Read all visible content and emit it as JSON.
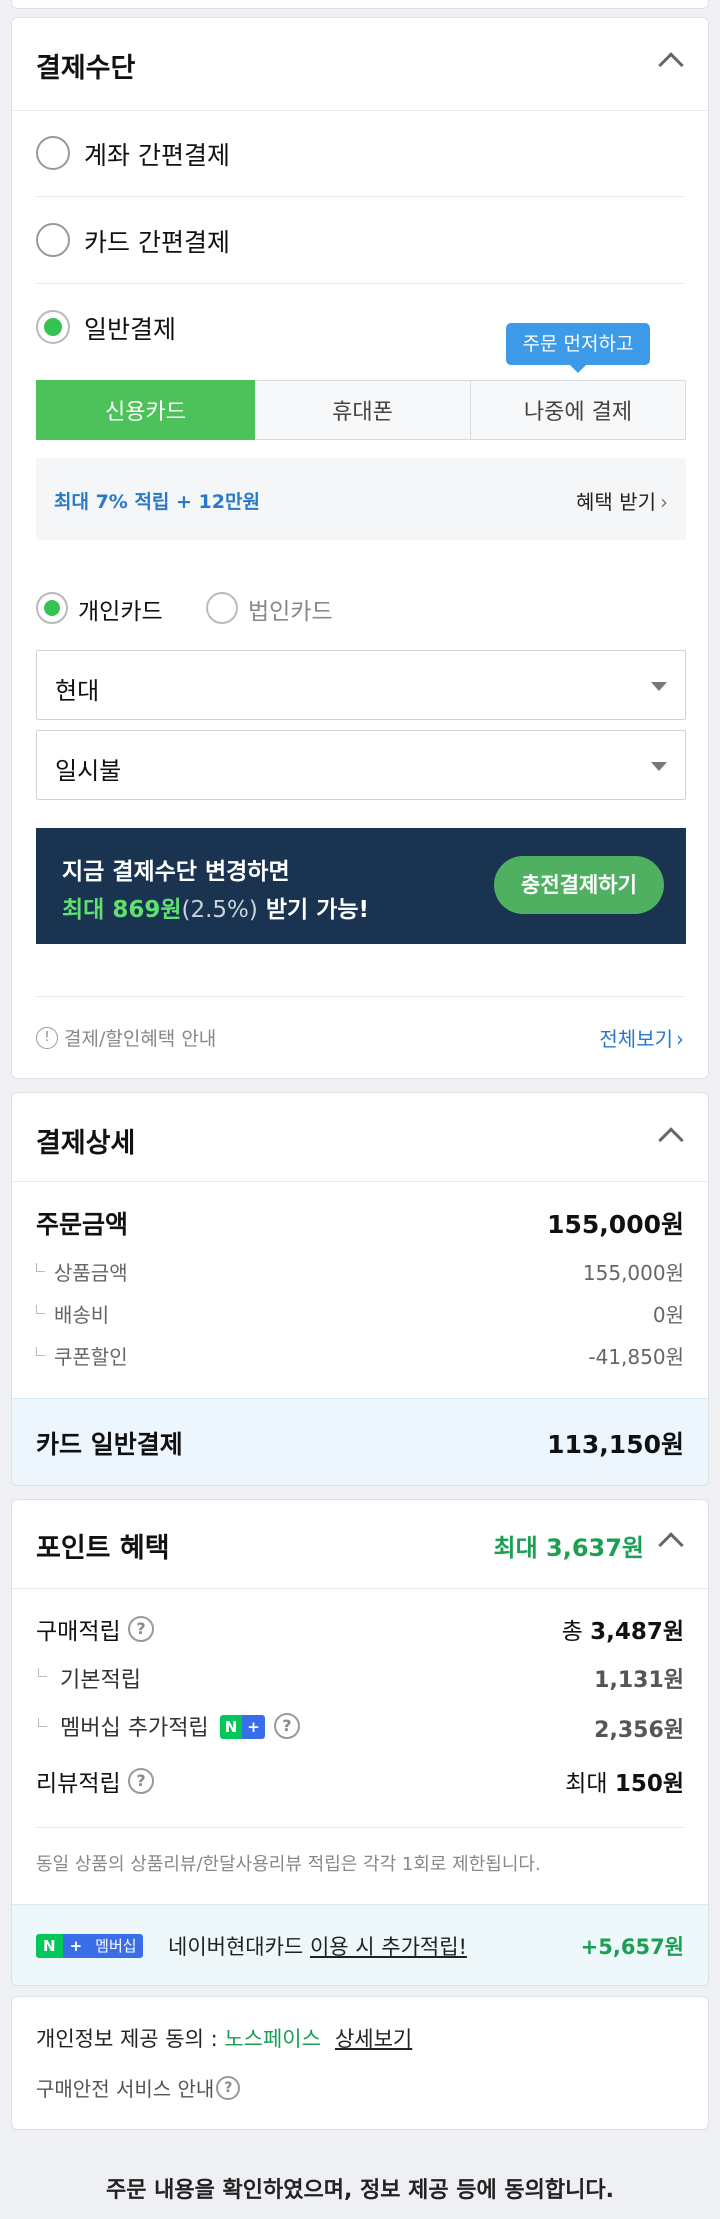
{
  "payment_method": {
    "title": "결제수단",
    "options": {
      "account_easy": "계좌 간편결제",
      "card_easy": "카드 간편결제",
      "general": "일반결제"
    },
    "tooltip": "주문 먼저하고",
    "tabs": {
      "credit_card": "신용카드",
      "phone": "휴대폰",
      "pay_later": "나중에 결제"
    },
    "benefit": {
      "text": "최대 7% 적립 + 12만원",
      "link": "혜택 받기"
    },
    "card_type": {
      "personal": "개인카드",
      "corporate": "법인카드"
    },
    "card_company": "현대",
    "installment": "일시불",
    "promo": {
      "line1": "지금 결제수단 변경하면",
      "highlight": "최대 869원",
      "pct": "(2.5%)",
      "suffix": " 받기 가능!",
      "button": "충전결제하기"
    },
    "notice": "결제/할인혜택 안내",
    "view_all": "전체보기"
  },
  "payment_detail": {
    "title": "결제상세",
    "order_amount_label": "주문금액",
    "order_amount_value": "155,000원",
    "rows": [
      {
        "label": "상품금액",
        "value": "155,000원"
      },
      {
        "label": "배송비",
        "value": "0원"
      },
      {
        "label": "쿠폰할인",
        "value": "-41,850원"
      }
    ],
    "total_label": "카드 일반결제",
    "total_value": "113,150원"
  },
  "points": {
    "title": "포인트 혜택",
    "max": "최대 3,637원",
    "purchase_label": "구매적립",
    "purchase_value_prefix": "총 ",
    "purchase_value": "3,487원",
    "basic_label": "기본적립",
    "basic_value": "1,131원",
    "membership_label": "멤버십 추가적립",
    "membership_value": "2,356원",
    "review_label": "리뷰적립",
    "review_value_prefix": "최대 ",
    "review_value": "150원",
    "note": "동일 상품의 상품리뷰/한달사용리뷰 적립은 각각 1회로 제한됩니다.",
    "badge_n": "N",
    "badge_plus": "+",
    "badge_member": "멤버십",
    "card_text": "네이버현대카드",
    "card_link": "이용 시 추가적립!",
    "card_value": "+5,657원"
  },
  "consent": {
    "label": "개인정보 제공 동의 : ",
    "company": "노스페이스",
    "detail_link": "상세보기",
    "safety": "구매안전 서비스 안내"
  },
  "footer": {
    "text": "주문 내용을 확인하였으며, 정보 제공 등에 동의합니다."
  },
  "colors": {
    "green": "#35c253",
    "navy": "#1a3350",
    "blue_link": "#2a78c8",
    "point_green": "#1a9f53"
  }
}
